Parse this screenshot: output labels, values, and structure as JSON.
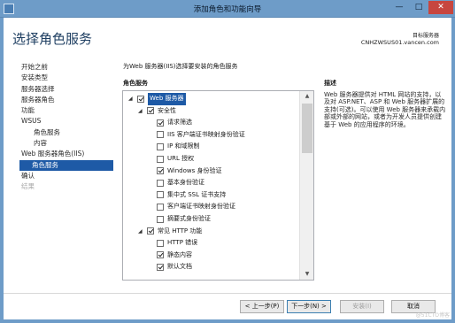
{
  "window": {
    "title": "添加角色和功能向导",
    "minimize": "—",
    "maximize": "□",
    "close": "✕",
    "accent_color": "#6e9cc8"
  },
  "header": {
    "title": "选择角色服务",
    "destination_label": "目标服务器",
    "destination_server": "CNHZWSUS01.vancen.com"
  },
  "nav": {
    "items": [
      {
        "label": "开始之前"
      },
      {
        "label": "安装类型"
      },
      {
        "label": "服务器选择"
      },
      {
        "label": "服务器角色"
      },
      {
        "label": "功能"
      },
      {
        "label": "WSUS"
      },
      {
        "label": "角色服务"
      },
      {
        "label": "内容"
      },
      {
        "label": "Web 服务器角色(IIS)"
      },
      {
        "label": "角色服务"
      },
      {
        "label": "确认"
      },
      {
        "label": "结果"
      }
    ]
  },
  "main": {
    "instruction": "为Web 服务器(IIS)选择要安装的角色服务",
    "pane_header": "角色服务",
    "tree": [
      {
        "label": "Web 服务器",
        "checked": true,
        "expander": "◢"
      },
      {
        "label": "安全性",
        "checked": true,
        "expander": "◢"
      },
      {
        "label": "请求筛选",
        "checked": true,
        "expander": ""
      },
      {
        "label": "IIS 客户端证书映射身份验证",
        "checked": false,
        "expander": ""
      },
      {
        "label": "IP 和域限制",
        "checked": false,
        "expander": ""
      },
      {
        "label": "URL 授权",
        "checked": false,
        "expander": ""
      },
      {
        "label": "Windows 身份验证",
        "checked": true,
        "expander": ""
      },
      {
        "label": "基本身份验证",
        "checked": false,
        "expander": ""
      },
      {
        "label": "集中式 SSL 证书支持",
        "checked": false,
        "expander": ""
      },
      {
        "label": "客户端证书映射身份验证",
        "checked": false,
        "expander": ""
      },
      {
        "label": "摘要式身份验证",
        "checked": false,
        "expander": ""
      },
      {
        "label": "常见 HTTP 功能",
        "checked": true,
        "expander": "◢"
      },
      {
        "label": "HTTP 错误",
        "checked": false,
        "expander": ""
      },
      {
        "label": "静态内容",
        "checked": true,
        "expander": ""
      },
      {
        "label": "默认文档",
        "checked": true,
        "expander": ""
      }
    ],
    "scroll_up": "▲",
    "scroll_down": "▼"
  },
  "description": {
    "header": "描述",
    "text": "Web 服务器提供对 HTML 网站的支持，以及对 ASP.NET、ASP 和 Web 服务器扩展的支持(可选)。可以使用 Web 服务器来承载内部或外部的网站，或者为开发人员提供创建基于 Web 的应用程序的环境。"
  },
  "footer": {
    "prev": "< 上一步(P)",
    "next": "下一步(N) >",
    "install": "安装(I)",
    "cancel": "取消",
    "watermark": "@51CTO博客"
  }
}
